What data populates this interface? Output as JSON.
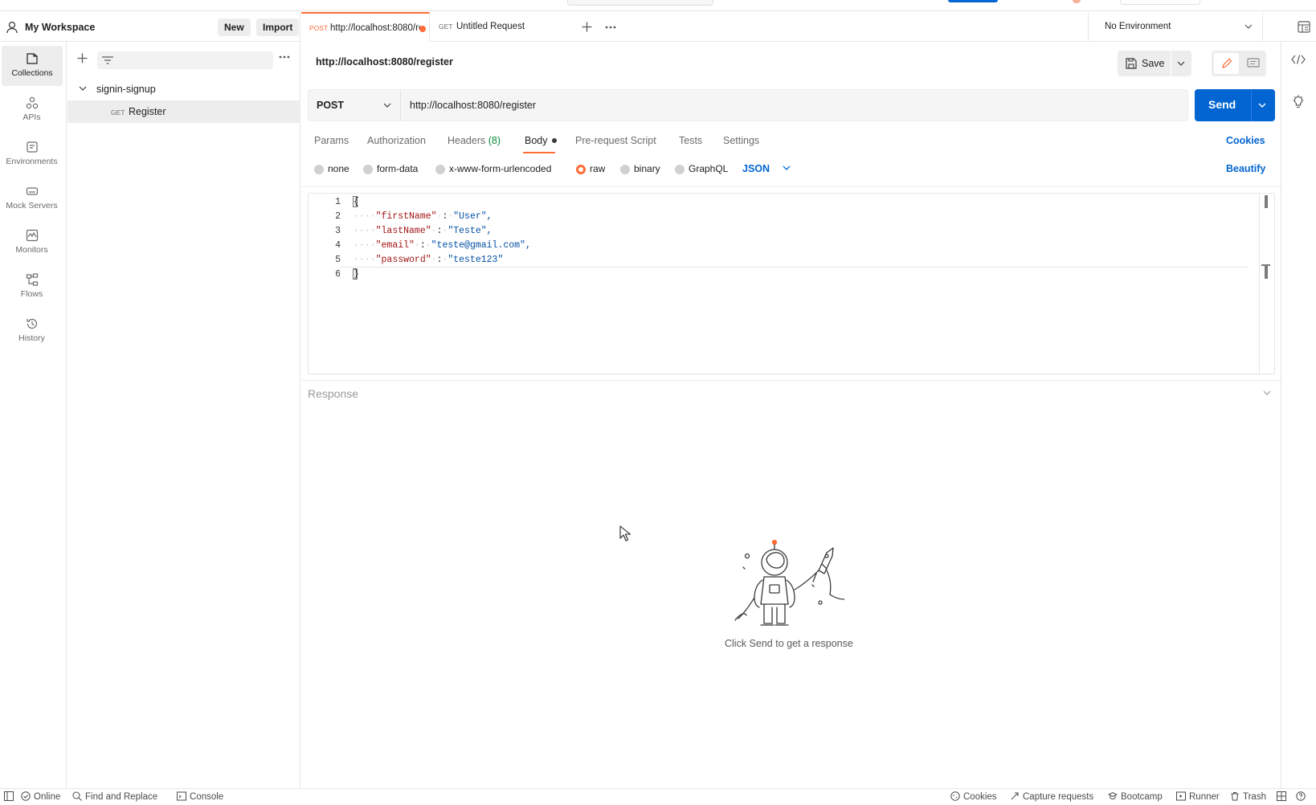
{
  "workspace": {
    "title": "My Workspace",
    "new_label": "New",
    "import_label": "Import"
  },
  "rail": {
    "items": [
      {
        "label": "Collections",
        "icon": "collections-icon",
        "active": true
      },
      {
        "label": "APIs",
        "icon": "apis-icon"
      },
      {
        "label": "Environments",
        "icon": "environments-icon"
      },
      {
        "label": "Mock Servers",
        "icon": "mock-servers-icon"
      },
      {
        "label": "Monitors",
        "icon": "monitors-icon"
      },
      {
        "label": "Flows",
        "icon": "flows-icon"
      },
      {
        "label": "History",
        "icon": "history-icon"
      }
    ]
  },
  "sidebar": {
    "filter_placeholder": "",
    "collection": {
      "name": "signin-signup"
    },
    "request": {
      "method": "GET",
      "name": "Register"
    }
  },
  "tabs": [
    {
      "method": "POST",
      "title": "http://localhost:8080/register",
      "unsaved": true,
      "active": true
    },
    {
      "method": "GET",
      "title": "Untitled Request",
      "active": false
    }
  ],
  "environment": {
    "selected": "No Environment"
  },
  "request": {
    "title": "http://localhost:8080/register",
    "save_label": "Save",
    "method": "POST",
    "url": "http://localhost:8080/register",
    "send_label": "Send",
    "tabs": [
      {
        "label": "Params"
      },
      {
        "label": "Authorization"
      },
      {
        "label": "Headers",
        "count": "(8)"
      },
      {
        "label": "Body",
        "active": true,
        "modified": true
      },
      {
        "label": "Pre-request Script"
      },
      {
        "label": "Tests"
      },
      {
        "label": "Settings"
      }
    ],
    "cookies_label": "Cookies",
    "body_modes": [
      "none",
      "form-data",
      "x-www-form-urlencoded",
      "raw",
      "binary",
      "GraphQL"
    ],
    "selected_mode": "raw",
    "language": "JSON",
    "beautify_label": "Beautify",
    "body_lines": [
      {
        "n": "1",
        "text": "{"
      },
      {
        "n": "2",
        "key": "\"firstName\"",
        "value": "\"User\","
      },
      {
        "n": "3",
        "key": "\"lastName\"",
        "value": "\"Teste\","
      },
      {
        "n": "4",
        "key": "\"email\"",
        "value": "\"teste@gmail.com\","
      },
      {
        "n": "5",
        "key": "\"password\"",
        "value": "\"teste123\""
      },
      {
        "n": "6",
        "text": "}"
      }
    ]
  },
  "response": {
    "title": "Response",
    "empty_message": "Click Send to get a response"
  },
  "statusbar": {
    "online": "Online",
    "find_replace": "Find and Replace",
    "console": "Console",
    "cookies": "Cookies",
    "capture": "Capture requests",
    "bootcamp": "Bootcamp",
    "runner": "Runner",
    "trash": "Trash"
  },
  "colors": {
    "accent": "#ff6c37",
    "primary": "#0265d2"
  }
}
